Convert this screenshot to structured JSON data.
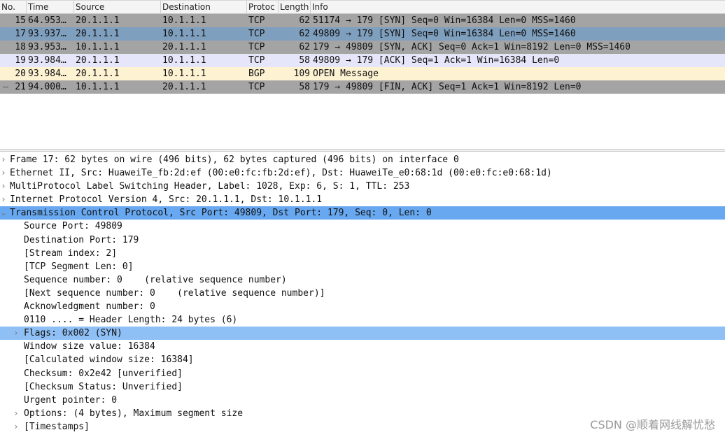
{
  "packet_list": {
    "columns": [
      "No.",
      "Time",
      "Source",
      "Destination",
      "Protoc",
      "Length",
      "Info"
    ],
    "rows": [
      {
        "no": "15",
        "time": "64.953…",
        "source": "20.1.1.1",
        "destination": "10.1.1.1",
        "protocol": "TCP",
        "length": "62",
        "info": "51174 → 179 [SYN] Seq=0 Win=16384 Len=0 MSS=1460",
        "bg": "#a4a4a4"
      },
      {
        "no": "17",
        "time": "93.937…",
        "source": "20.1.1.1",
        "destination": "10.1.1.1",
        "protocol": "TCP",
        "length": "62",
        "info": "49809 → 179 [SYN] Seq=0 Win=16384 Len=0 MSS=1460",
        "bg": "#7f9fbe"
      },
      {
        "no": "18",
        "time": "93.953…",
        "source": "10.1.1.1",
        "destination": "20.1.1.1",
        "protocol": "TCP",
        "length": "62",
        "info": "179 → 49809 [SYN, ACK] Seq=0 Ack=1 Win=8192 Len=0 MSS=1460",
        "bg": "#a4a4a4"
      },
      {
        "no": "19",
        "time": "93.984…",
        "source": "20.1.1.1",
        "destination": "10.1.1.1",
        "protocol": "TCP",
        "length": "58",
        "info": "49809 → 179 [ACK] Seq=1 Ack=1 Win=16384 Len=0",
        "bg": "#e6e6fa"
      },
      {
        "no": "20",
        "time": "93.984…",
        "source": "20.1.1.1",
        "destination": "10.1.1.1",
        "protocol": "BGP",
        "length": "109",
        "info": "OPEN Message",
        "bg": "#fdf2d2"
      },
      {
        "no": "21",
        "time": "94.000…",
        "source": "10.1.1.1",
        "destination": "20.1.1.1",
        "protocol": "TCP",
        "length": "58",
        "info": "179 → 49809 [FIN, ACK] Seq=1 Ack=1 Win=8192 Len=0",
        "bg": "#a4a4a4"
      }
    ]
  },
  "details": [
    {
      "level": 0,
      "arrow": "›",
      "text": "Frame 17: 62 bytes on wire (496 bits), 62 bytes captured (496 bits) on interface 0",
      "selected": false
    },
    {
      "level": 0,
      "arrow": "›",
      "text": "Ethernet II, Src: HuaweiTe_fb:2d:ef (00:e0:fc:fb:2d:ef), Dst: HuaweiTe_e0:68:1d (00:e0:fc:e0:68:1d)",
      "selected": false
    },
    {
      "level": 0,
      "arrow": "›",
      "text": "MultiProtocol Label Switching Header, Label: 1028, Exp: 6, S: 1, TTL: 253",
      "selected": false
    },
    {
      "level": 0,
      "arrow": "›",
      "text": "Internet Protocol Version 4, Src: 20.1.1.1, Dst: 10.1.1.1",
      "selected": false
    },
    {
      "level": 0,
      "arrow": "⌄",
      "text": "Transmission Control Protocol, Src Port: 49809, Dst Port: 179, Seq: 0, Len: 0",
      "selected": true
    },
    {
      "level": 1,
      "arrow": "",
      "text": "Source Port: 49809",
      "selected": false
    },
    {
      "level": 1,
      "arrow": "",
      "text": "Destination Port: 179",
      "selected": false
    },
    {
      "level": 1,
      "arrow": "",
      "text": "[Stream index: 2]",
      "selected": false
    },
    {
      "level": 1,
      "arrow": "",
      "text": "[TCP Segment Len: 0]",
      "selected": false
    },
    {
      "level": 1,
      "arrow": "",
      "text": "Sequence number: 0    (relative sequence number)",
      "selected": false
    },
    {
      "level": 1,
      "arrow": "",
      "text": "[Next sequence number: 0    (relative sequence number)]",
      "selected": false
    },
    {
      "level": 1,
      "arrow": "",
      "text": "Acknowledgment number: 0",
      "selected": false
    },
    {
      "level": 1,
      "arrow": "",
      "text": "0110 .... = Header Length: 24 bytes (6)",
      "selected": false
    },
    {
      "level": 1,
      "arrow": "›",
      "text": "Flags: 0x002 (SYN)",
      "selected": "partial"
    },
    {
      "level": 1,
      "arrow": "",
      "text": "Window size value: 16384",
      "selected": false
    },
    {
      "level": 1,
      "arrow": "",
      "text": "[Calculated window size: 16384]",
      "selected": false
    },
    {
      "level": 1,
      "arrow": "",
      "text": "Checksum: 0x2e42 [unverified]",
      "selected": false
    },
    {
      "level": 1,
      "arrow": "",
      "text": "[Checksum Status: Unverified]",
      "selected": false
    },
    {
      "level": 1,
      "arrow": "",
      "text": "Urgent pointer: 0",
      "selected": false
    },
    {
      "level": 1,
      "arrow": "›",
      "text": "Options: (4 bytes), Maximum segment size",
      "selected": false
    },
    {
      "level": 1,
      "arrow": "›",
      "text": "[Timestamps]",
      "selected": false
    }
  ],
  "watermark": "CSDN @顺着网线解忧愁",
  "colors": {
    "selection": "#68a8f0",
    "selection_partial": "#8fc0f5"
  }
}
